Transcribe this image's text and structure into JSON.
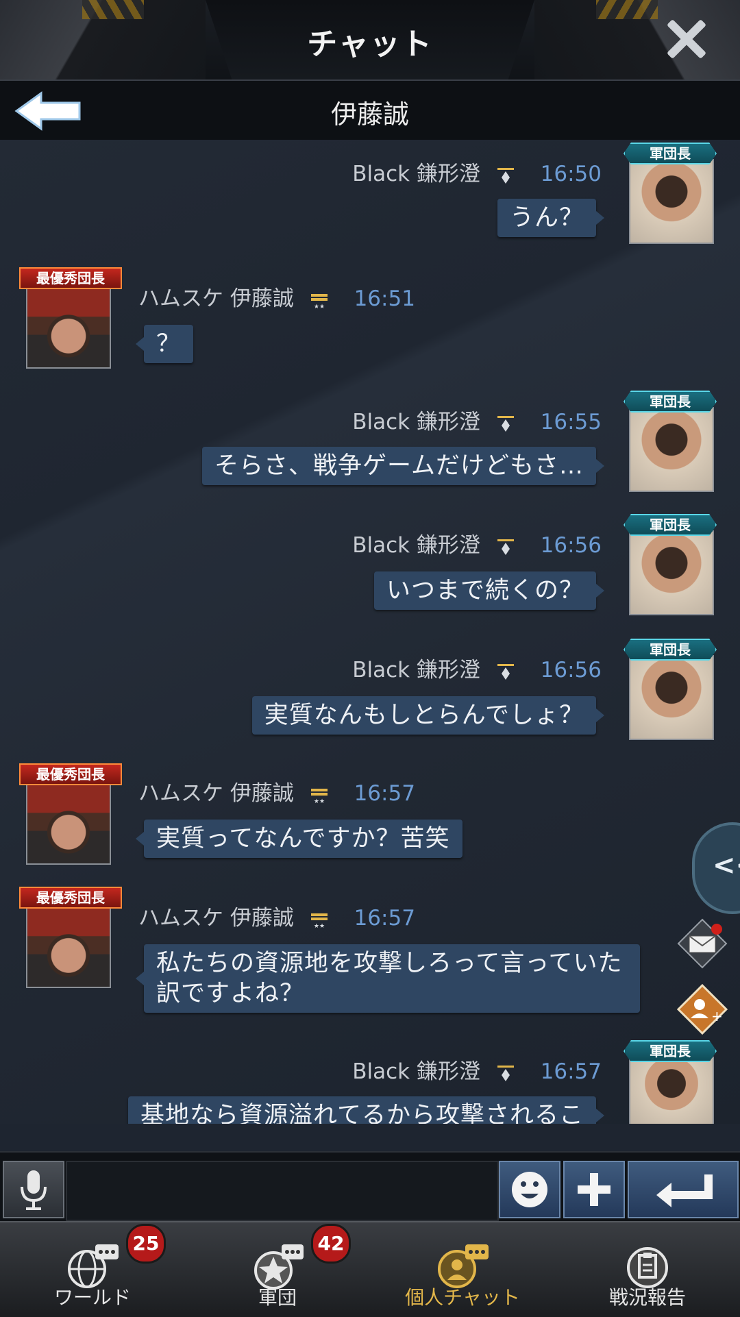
{
  "header": {
    "title": "チャット",
    "close_icon": "close-icon"
  },
  "subheader": {
    "name": "伊藤誠",
    "back_icon": "back-arrow-icon"
  },
  "colors": {
    "bubble": "#2f4662",
    "time": "#6c9bd3",
    "active_tab": "#e2b64a",
    "badge_red": "#b51a1a"
  },
  "messages": [
    {
      "side": "right",
      "rank": "軍団長",
      "alliance": "Black",
      "sender": "鎌形澄",
      "time": "16:50",
      "text": "うん？"
    },
    {
      "side": "left",
      "rank": "最優秀団長",
      "alliance": "ハムスケ",
      "sender": "伊藤誠",
      "time": "16:51",
      "text": "？"
    },
    {
      "side": "right",
      "rank": "軍団長",
      "alliance": "Black",
      "sender": "鎌形澄",
      "time": "16:55",
      "text": "そらさ、戦争ゲームだけどもさ…"
    },
    {
      "side": "right",
      "rank": "軍団長",
      "alliance": "Black",
      "sender": "鎌形澄",
      "time": "16:56",
      "text": "いつまで続くの？"
    },
    {
      "side": "right",
      "rank": "軍団長",
      "alliance": "Black",
      "sender": "鎌形澄",
      "time": "16:56",
      "text": "実質なんもしとらんでしょ？"
    },
    {
      "side": "left",
      "rank": "最優秀団長",
      "alliance": "ハムスケ",
      "sender": "伊藤誠",
      "time": "16:57",
      "text": "実質ってなんですか？苦笑"
    },
    {
      "side": "left",
      "rank": "最優秀団長",
      "alliance": "ハムスケ",
      "sender": "伊藤誠",
      "time": "16:57",
      "text": "私たちの資源地を攻撃しろって言っていた訳ですよね？"
    },
    {
      "side": "right",
      "rank": "軍団長",
      "alliance": "Black",
      "sender": "鎌形澄",
      "time": "16:57",
      "text": "基地なら資源溢れてるから攻撃されるこ"
    }
  ],
  "side_panel": {
    "collapse_label": "<<",
    "mail_icon": "mail-icon",
    "friend_add_icon": "friend-add-icon"
  },
  "input": {
    "placeholder": "",
    "mic_icon": "microphone-icon",
    "emoji_icon": "smiley-icon",
    "plus_icon": "plus-icon",
    "send_icon": "enter-icon"
  },
  "tabs": [
    {
      "label": "ワールド",
      "count": "25",
      "icon": "globe-chat-icon",
      "active": false
    },
    {
      "label": "軍団",
      "count": "42",
      "icon": "star-chat-icon",
      "active": false
    },
    {
      "label": "個人チャット",
      "count": "",
      "icon": "person-chat-icon",
      "active": true
    },
    {
      "label": "戦況報告",
      "count": "",
      "icon": "report-icon",
      "active": false
    }
  ]
}
